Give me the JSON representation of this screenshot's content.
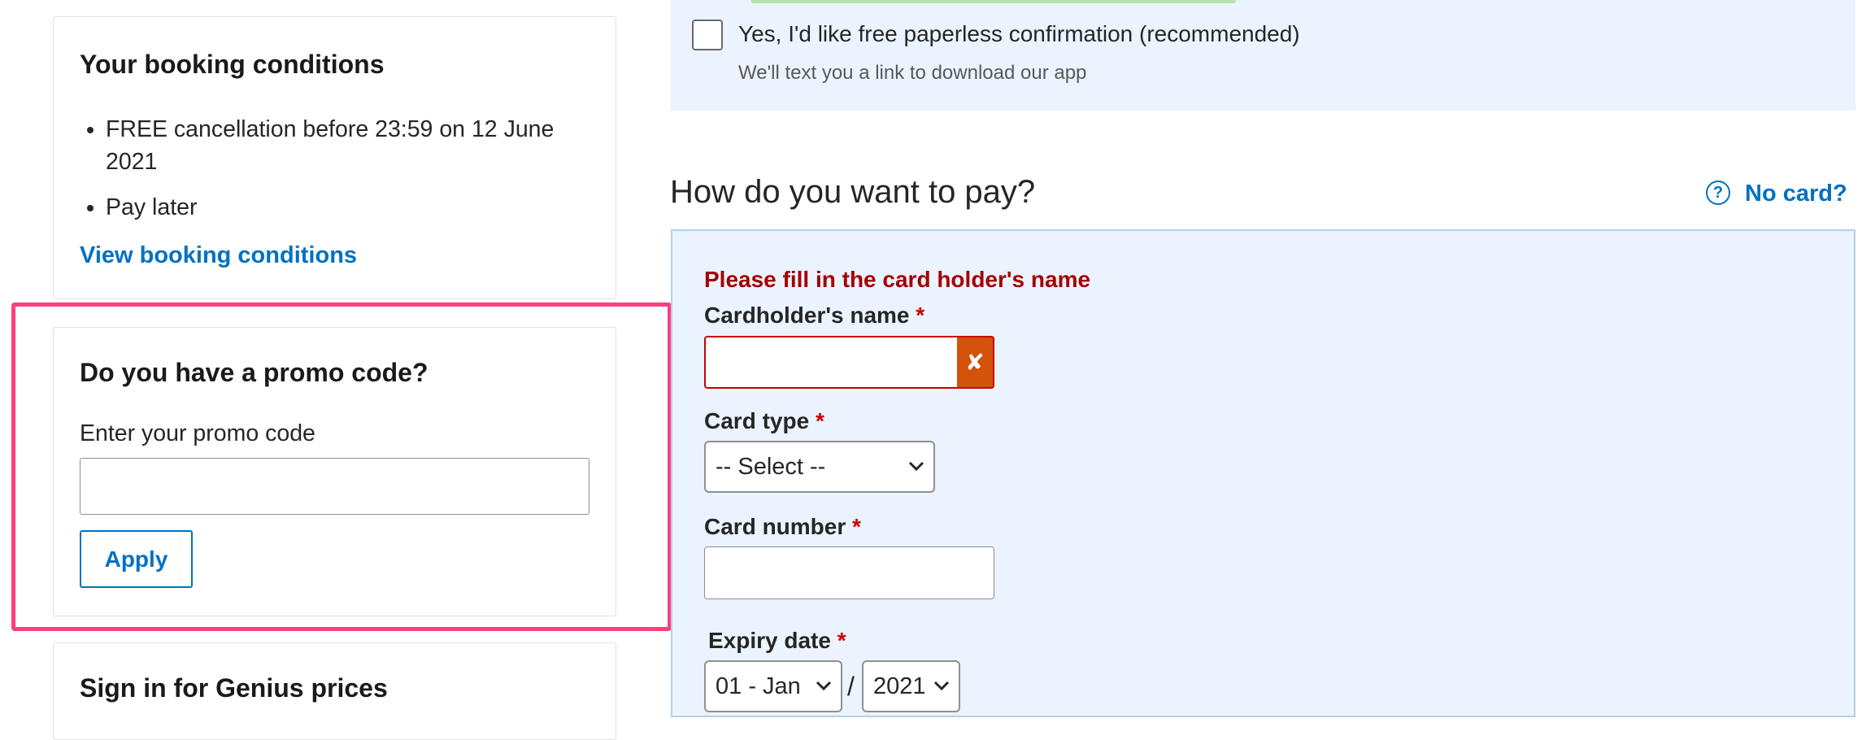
{
  "booking_conditions": {
    "title": "Your booking conditions",
    "items": [
      "FREE cancellation before 23:59 on 12 June 2021",
      "Pay later"
    ],
    "link": "View booking conditions"
  },
  "promo": {
    "title": "Do you have a promo code?",
    "label": "Enter your promo code",
    "input_value": "",
    "apply_label": "Apply"
  },
  "genius": {
    "title": "Sign in for Genius prices"
  },
  "paperless": {
    "label": "Yes, I'd like free paperless confirmation (recommended)",
    "hint": "We'll text you a link to download our app",
    "checked": false
  },
  "payment": {
    "title": "How do you want to pay?",
    "no_card_label": "No card?",
    "error_message": "Please fill in the card holder's name",
    "required_mark": "*",
    "cardholder_label": "Cardholder's name",
    "cardholder_value": "",
    "card_type_label": "Card type",
    "card_type_selected": "-- Select --",
    "card_number_label": "Card number",
    "card_number_value": "",
    "expiry_label": "Expiry date",
    "expiry_month_selected": "01 - Jan",
    "expiry_separator": "/",
    "expiry_year_selected": "2021"
  },
  "colors": {
    "accent": "#0071c2",
    "error": "#a30000",
    "highlight": "#ff3d7f",
    "panel_bg": "#ebf3ff"
  }
}
